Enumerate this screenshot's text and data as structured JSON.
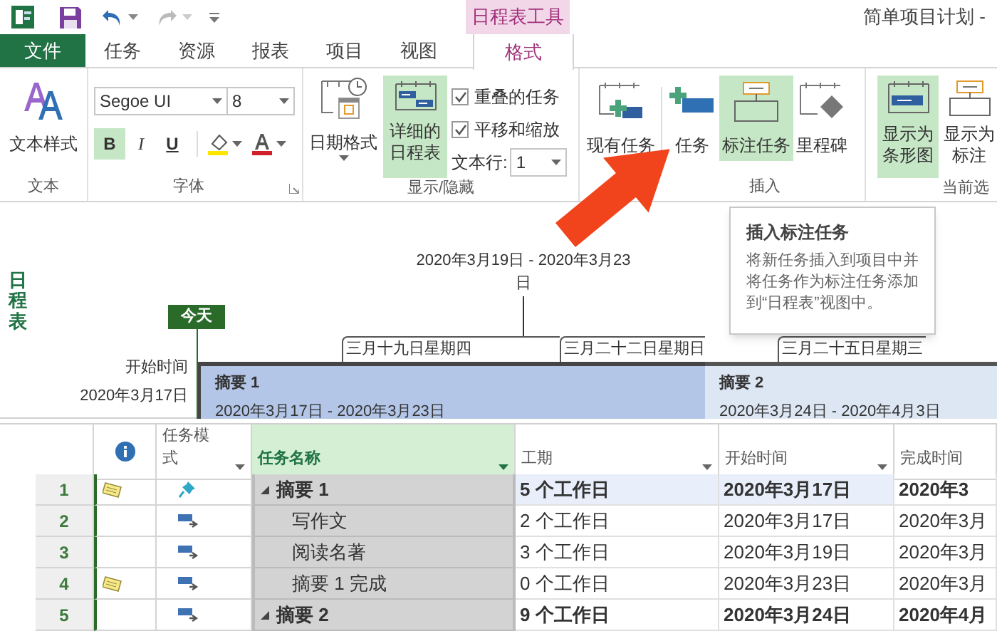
{
  "context_tab_header": "日程表工具",
  "window_title": "简单项目计划 -",
  "tabs": [
    {
      "label": "文件",
      "kind": "file",
      "selected": false
    },
    {
      "label": "任务",
      "kind": "tab",
      "selected": false
    },
    {
      "label": "资源",
      "kind": "tab",
      "selected": false
    },
    {
      "label": "报表",
      "kind": "tab",
      "selected": false
    },
    {
      "label": "项目",
      "kind": "tab",
      "selected": false
    },
    {
      "label": "视图",
      "kind": "tab",
      "selected": false
    },
    {
      "label": "格式",
      "kind": "tab",
      "selected": true
    }
  ],
  "ribbon": {
    "text_group": {
      "label": "文本",
      "button": "文本样式"
    },
    "font_group": {
      "label": "字体",
      "font": "Segoe UI",
      "size": "8",
      "format_buttons": [
        {
          "label": "B",
          "selected": true
        },
        {
          "label": "I",
          "selected": false
        },
        {
          "label": "U",
          "selected": false
        }
      ]
    },
    "show_hide": {
      "label": "显示/隐藏",
      "date_format": "日期格式",
      "detailed": {
        "label": "详细的日程表",
        "selected": true
      },
      "checkboxes": [
        {
          "label": "重叠的任务",
          "checked": true
        },
        {
          "label": "平移和缩放",
          "checked": true
        }
      ],
      "text_lines": {
        "label": "文本行:",
        "value": "1"
      }
    },
    "insert": {
      "label": "插入",
      "buttons": [
        {
          "label": "现有任务",
          "kind": "existing",
          "selected": false
        },
        {
          "label": "任务",
          "kind": "task",
          "selected": false
        },
        {
          "label": "标注任务",
          "kind": "callout",
          "selected": true
        },
        {
          "label": "里程碑",
          "kind": "milestone",
          "selected": false
        }
      ]
    },
    "current_selection": {
      "label": "当前选",
      "buttons": [
        {
          "label": "显示为条形图",
          "kind": "bar",
          "selected": true
        },
        {
          "label": "显示为标注",
          "kind": "callout",
          "selected": false
        }
      ]
    }
  },
  "timeline": {
    "side_label": "日程表",
    "today": "今天",
    "start": {
      "label": "开始时间",
      "date": "2020年3月17日"
    },
    "callout": {
      "dates": "2020年3月19日 - 2020年3月23日"
    },
    "date_labels": [
      "三月十九日星期四",
      "三月二十二日星期日",
      "三月二十五日星期三"
    ],
    "bars": [
      {
        "title": "摘要 1",
        "dates": "2020年3月17日 - 2020年3月23日",
        "selected": true
      },
      {
        "title": "摘要 2",
        "dates": "2020年3月24日 - 2020年4月3日",
        "selected": false
      }
    ]
  },
  "tooltip": {
    "title": "插入标注任务",
    "body": "将新任务插入到项目中并将任务作为标注任务添加到“日程表”视图中。"
  },
  "table": {
    "columns": [
      "任务模式",
      "任务名称",
      "工期",
      "开始时间",
      "完成时间"
    ],
    "rows": [
      {
        "id": "1",
        "note": true,
        "kind": "manual",
        "name": "摘要 1",
        "summary": true,
        "expanded": true,
        "selected": true,
        "duration": "5 个工作日",
        "start": "2020年3月17日",
        "finish": "2020年3",
        "children": [
          {
            "id": "2",
            "note": false,
            "kind": "auto",
            "name": "写作文",
            "summary": false,
            "selected": false,
            "duration": "2 个工作日",
            "start": "2020年3月17日",
            "finish": "2020年3月"
          },
          {
            "id": "3",
            "note": false,
            "kind": "auto",
            "name": "阅读名著",
            "summary": false,
            "selected": false,
            "duration": "3 个工作日",
            "start": "2020年3月19日",
            "finish": "2020年3月"
          },
          {
            "id": "4",
            "note": true,
            "kind": "auto",
            "name": "摘要 1 完成",
            "summary": false,
            "selected": false,
            "duration": "0 个工作日",
            "start": "2020年3月23日",
            "finish": "2020年3月"
          }
        ]
      },
      {
        "id": "5",
        "note": false,
        "kind": "auto",
        "name": "摘要 2",
        "summary": true,
        "expanded": true,
        "selected": false,
        "duration": "9 个工作日",
        "start": "2020年3月24日",
        "finish": "2020年4月"
      }
    ]
  }
}
